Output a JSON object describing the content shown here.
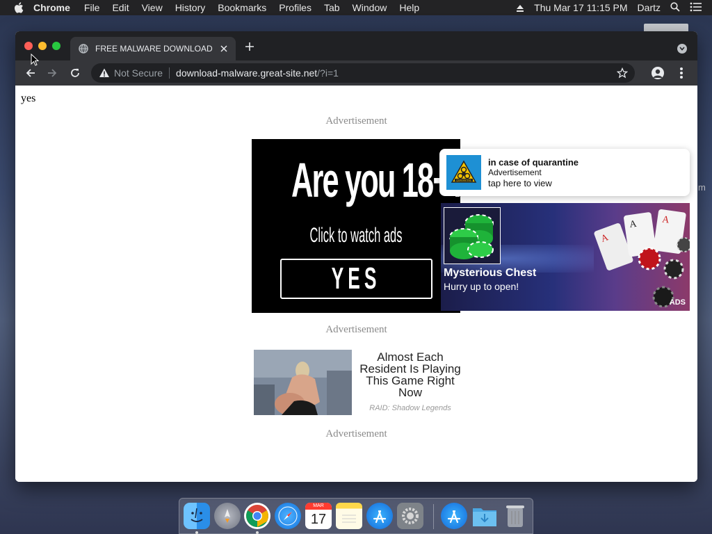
{
  "menubar": {
    "app_name": "Chrome",
    "items": [
      "File",
      "Edit",
      "View",
      "History",
      "Bookmarks",
      "Profiles",
      "Tab",
      "Window",
      "Help"
    ],
    "clock": "Thu Mar 17  11:15 PM",
    "user": "Dartz"
  },
  "desktop": {
    "edge_text": "m"
  },
  "browser": {
    "tab_title": "FREE MALWARE DOWNLOAD",
    "omnibox": {
      "security_label": "Not Secure",
      "host": "download-malware.great-site.net",
      "path": "/?i=1"
    }
  },
  "page": {
    "yes_text": "yes",
    "ad_label": "Advertisement",
    "age_ad": {
      "headline": "Are you 18+?",
      "subline": "Click to watch ads",
      "button": "YES"
    },
    "raid_ad": {
      "headline": "Almost Each Resident Is Playing This Game Right Now",
      "source": "RAID: Shadow Legends"
    },
    "notification": {
      "icon_label": "QUARANTINE",
      "title": "in case of quarantine",
      "subtitle": "Advertisement",
      "action": "tap here to view"
    },
    "chest_ad": {
      "title": "Mysterious Chest",
      "subtitle": "Hurry up to open!",
      "badge": "ADS"
    }
  },
  "dock": {
    "calendar_month": "MAR",
    "calendar_day": "17",
    "apps": [
      "Finder",
      "Launchpad",
      "Google Chrome",
      "Safari",
      "Calendar",
      "Notes",
      "App Store",
      "System Preferences",
      "App Store",
      "Downloads",
      "Trash"
    ]
  }
}
